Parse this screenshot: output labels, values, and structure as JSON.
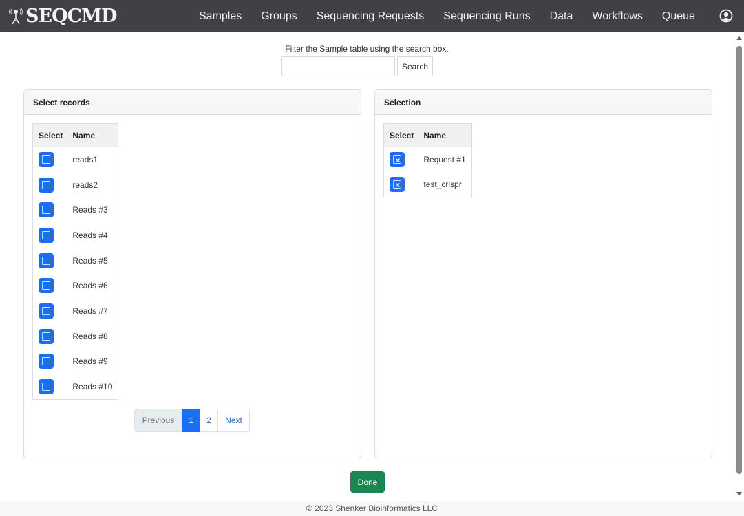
{
  "navbar": {
    "brand": "SEQCMD",
    "links": [
      "Samples",
      "Groups",
      "Sequencing Requests",
      "Sequencing Runs",
      "Data",
      "Workflows",
      "Queue"
    ],
    "user_icon": "user-circle-icon"
  },
  "filter": {
    "instructions": "Filter the Sample table using the search box.",
    "search_value": "",
    "search_placeholder": "",
    "search_label": "Search"
  },
  "select_records": {
    "title": "Select records",
    "columns": [
      "Select",
      "Name"
    ],
    "rows": [
      {
        "name": "reads1",
        "checked": false
      },
      {
        "name": "reads2",
        "checked": false
      },
      {
        "name": "Reads #3",
        "checked": false
      },
      {
        "name": "Reads #4",
        "checked": false
      },
      {
        "name": "Reads #5",
        "checked": false
      },
      {
        "name": "Reads #6",
        "checked": false
      },
      {
        "name": "Reads #7",
        "checked": false
      },
      {
        "name": "Reads #8",
        "checked": false
      },
      {
        "name": "Reads #9",
        "checked": false
      },
      {
        "name": "Reads #10",
        "checked": false
      }
    ],
    "pagination": {
      "previous": "Previous",
      "pages": [
        "1",
        "2"
      ],
      "current_page": "1",
      "next": "Next"
    }
  },
  "selection": {
    "title": "Selection",
    "columns": [
      "Select",
      "Name"
    ],
    "rows": [
      {
        "name": "Request #1",
        "checked": true
      },
      {
        "name": "test_crispr",
        "checked": true
      }
    ]
  },
  "actions": {
    "done_label": "Done"
  },
  "footer": {
    "text": "© 2023 Shenker Bioinformatics LLC"
  },
  "colors": {
    "navbar": "#3f4144",
    "primary": "#1a6ef5",
    "success": "#198754"
  }
}
